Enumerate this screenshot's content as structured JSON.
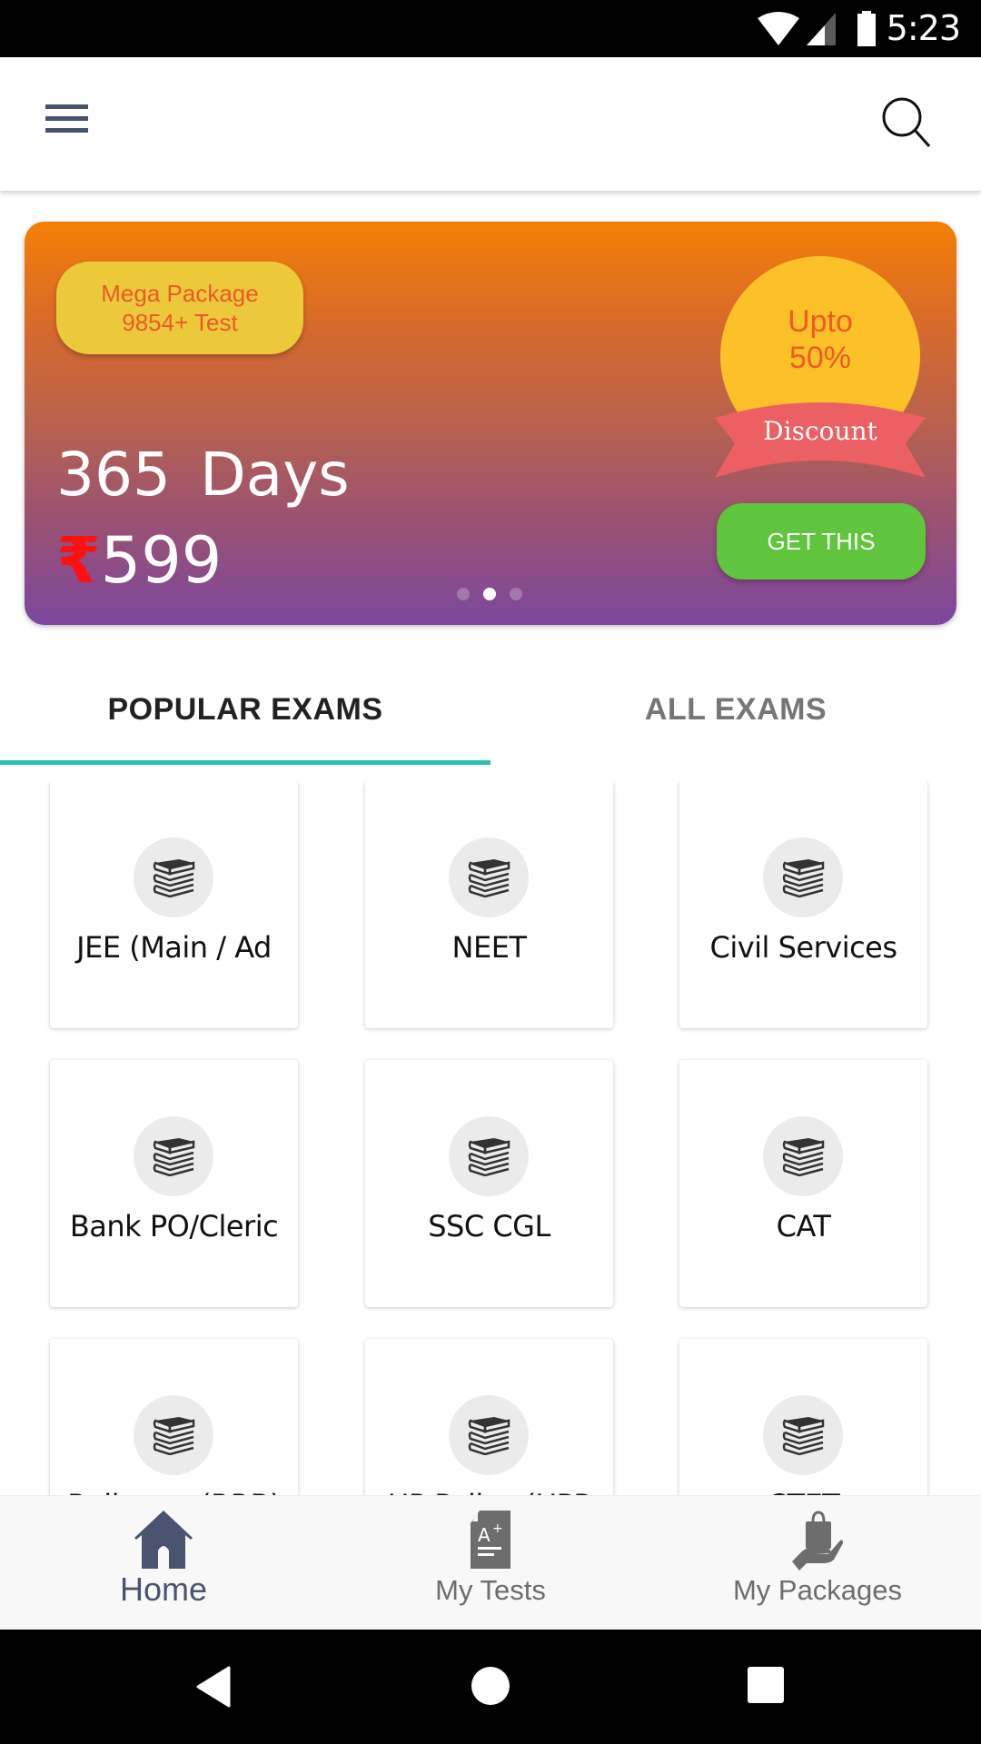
{
  "status_bar": {
    "time": "5:23",
    "icons": [
      "wifi-icon",
      "signal-icon",
      "battery-icon"
    ]
  },
  "app_bar": {
    "menu_icon": "hamburger-menu-icon",
    "search_icon": "search-icon"
  },
  "banner": {
    "package_line1": "Mega Package",
    "package_line2": "9854+ Test",
    "days_number": "365",
    "days_unit": "Days",
    "currency_symbol": "₹",
    "price": "599",
    "discount_line1": "Upto",
    "discount_line2": "50%",
    "discount_ribbon": "Discount",
    "cta_label": "GET THIS",
    "carousel": {
      "total": 3,
      "active_index": 1
    },
    "colors": {
      "gradient_top": "#f47f04",
      "gradient_bottom": "#7c479e",
      "pill": "#ecc93a",
      "circle": "#fcc128",
      "ribbon": "#ec5f62",
      "cta": "#5ec53d",
      "rupee": "#ff1010"
    }
  },
  "tabs": [
    {
      "label": "POPULAR EXAMS",
      "active": true
    },
    {
      "label": "ALL EXAMS",
      "active": false
    }
  ],
  "tab_indicator_color": "#26c3ad",
  "exams": [
    {
      "label": "JEE (Main / Ad",
      "icon": "books-icon"
    },
    {
      "label": "NEET",
      "icon": "books-icon"
    },
    {
      "label": "Civil Services",
      "icon": "books-icon"
    },
    {
      "label": "Bank PO/Cleric",
      "icon": "books-icon"
    },
    {
      "label": "SSC CGL",
      "icon": "books-icon"
    },
    {
      "label": "CAT",
      "icon": "books-icon"
    },
    {
      "label": "Railways (RRB)",
      "icon": "books-icon"
    },
    {
      "label": "UP Police (UPP",
      "icon": "books-icon"
    },
    {
      "label": "CTET",
      "icon": "books-icon"
    }
  ],
  "bottom_nav": [
    {
      "label": "Home",
      "icon": "home-icon",
      "active": true
    },
    {
      "label": "My Tests",
      "icon": "test-sheet-icon",
      "active": false
    },
    {
      "label": "My Packages",
      "icon": "package-hand-icon",
      "active": false
    }
  ],
  "bottom_nav_colors": {
    "active": "#4a5370",
    "inactive": "#6d6d6d"
  },
  "system_nav": [
    "back-icon",
    "home-circle-icon",
    "recents-icon"
  ]
}
